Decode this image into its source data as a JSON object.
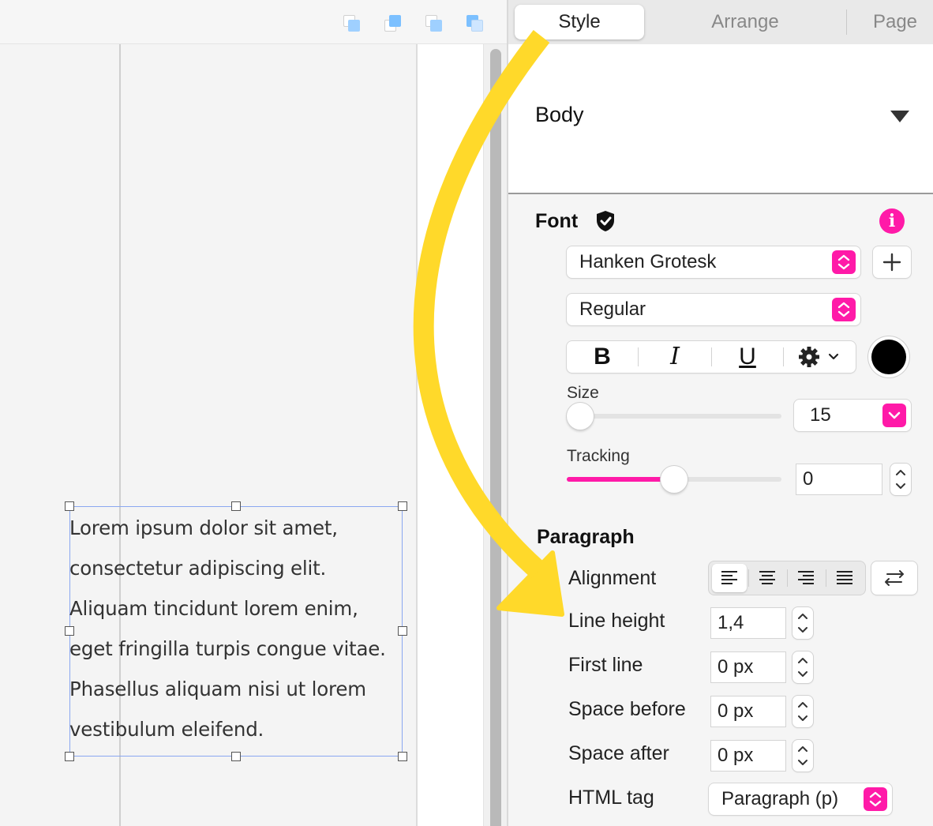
{
  "canvas": {
    "text_lines": [
      "Lorem ipsum dolor sit amet,",
      "consectetur adipiscing elit.",
      "Aliquam tincidunt lorem enim,",
      "eget fringilla turpis congue vitae.",
      "Phasellus aliquam nisi ut lorem",
      "vestibulum eleifend."
    ],
    "layer_buttons": [
      "bring-forward-icon",
      "send-backward-icon",
      "bring-to-front-icon",
      "send-to-back-icon"
    ]
  },
  "inspector": {
    "tabs": [
      {
        "label": "Style",
        "active": true
      },
      {
        "label": "Arrange",
        "active": false
      },
      {
        "label": "Page",
        "active": false
      }
    ],
    "paragraph_style": "Body",
    "font": {
      "title": "Font",
      "family": "Hanken Grotesk",
      "weight": "Regular",
      "bold_label": "B",
      "italic_label": "I",
      "underline_label": "U",
      "color": "#000000",
      "size_label": "Size",
      "size_value": "15",
      "size_slider_fraction": 0.05,
      "tracking_label": "Tracking",
      "tracking_value": "0",
      "tracking_slider_fraction": 0.5
    },
    "paragraph": {
      "title": "Paragraph",
      "alignment_label": "Alignment",
      "alignment_options": [
        "left",
        "center",
        "right",
        "justify"
      ],
      "alignment_selected": "left",
      "line_height_label": "Line height",
      "line_height_value": "1,4",
      "first_line_label": "First line",
      "first_line_value": "0 px",
      "space_before_label": "Space before",
      "space_before_value": "0 px",
      "space_after_label": "Space after",
      "space_after_value": "0 px",
      "html_tag_label": "HTML tag",
      "html_tag_value": "Paragraph (p)"
    }
  },
  "colors": {
    "accent": "#ff1aa8",
    "annotation_arrow": "#ffd92a",
    "selection": "#8aa7f0"
  }
}
